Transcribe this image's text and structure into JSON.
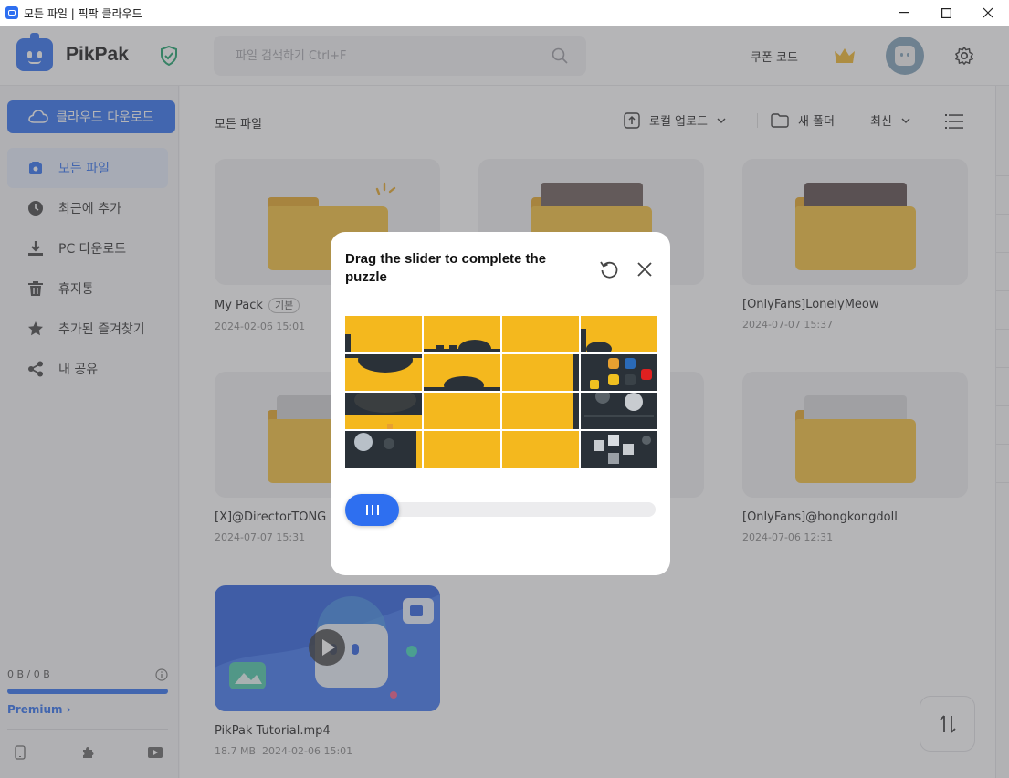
{
  "window": {
    "title": "모든 파일 | 픽팍 클라우드"
  },
  "header": {
    "brand": "PikPak",
    "search_placeholder": "파일 검색하기 Ctrl+F",
    "coupon": "쿠폰 코드"
  },
  "sidebar": {
    "cloud_download": "클라우드 다운로드",
    "items": [
      {
        "label": "모든 파일",
        "icon": "folder-icon",
        "active": true
      },
      {
        "label": "최근에 추가",
        "icon": "clock-icon"
      },
      {
        "label": "PC 다운로드",
        "icon": "download-icon"
      },
      {
        "label": "휴지통",
        "icon": "trash-icon"
      },
      {
        "label": "추가된 즐겨찾기",
        "icon": "star-icon"
      },
      {
        "label": "내 공유",
        "icon": "share-icon"
      }
    ],
    "storage": "0 B / 0 B",
    "premium": "Premium"
  },
  "main": {
    "breadcrumb": "모든 파일",
    "toolbar": {
      "upload": "로컬 업로드",
      "new_folder": "새 폴더",
      "sort": "최신"
    },
    "files": [
      {
        "name": "My Pack",
        "tag": "기본",
        "date": "2024-02-06 15:01"
      },
      {
        "name": "",
        "date": ""
      },
      {
        "name": "[OnlyFans]LonelyMeow",
        "date": "2024-07-07 15:37"
      },
      {
        "name": "[X]@DirectorTONG -",
        "date": "2024-07-07 15:31"
      },
      {
        "name": "",
        "date": ""
      },
      {
        "name": "[OnlyFans]@hongkongdoll",
        "date": "2024-07-06 12:31"
      },
      {
        "name": "PikPak Tutorial.mp4",
        "size": "18.7 MB",
        "date": "2024-02-06 15:01"
      }
    ]
  },
  "captcha": {
    "title": "Drag the slider to complete the puzzle",
    "slider_progress": 0.0
  },
  "colors": {
    "accent": "#2e6ff0",
    "folder": "#f5c03a",
    "puzzle_yellow": "#f4b81e"
  }
}
